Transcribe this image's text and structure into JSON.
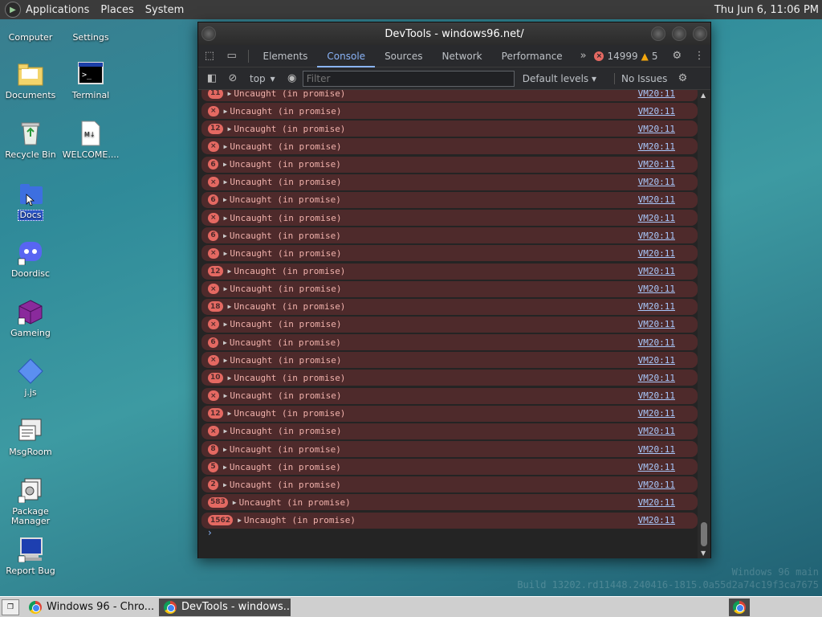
{
  "top_panel": {
    "menus": [
      "Applications",
      "Places",
      "System"
    ],
    "clock": "Thu Jun  6, 11:06 PM"
  },
  "desktop_icons": [
    {
      "label": "Computer"
    },
    {
      "label": "Settings"
    },
    {
      "label": "Documents"
    },
    {
      "label": "Terminal"
    },
    {
      "label": "Recycle Bin"
    },
    {
      "label": "WELCOME...."
    },
    {
      "label": "Docs"
    },
    {
      "label": "Doordisc"
    },
    {
      "label": "Gameing"
    },
    {
      "label": "j.js"
    },
    {
      "label": "MsgRoom"
    },
    {
      "label": "Package Manager"
    },
    {
      "label": "Report Bug"
    }
  ],
  "devtools": {
    "title": "DevTools - windows96.net/",
    "tabs": [
      "Elements",
      "Console",
      "Sources",
      "Network",
      "Performance"
    ],
    "active_tab": "Console",
    "more_tabs": "»",
    "error_count": "14999",
    "warning_count": "5",
    "toolbar": {
      "context": "top",
      "filter_placeholder": "Filter",
      "levels": "Default levels",
      "issues": "No Issues"
    },
    "messages": [
      {
        "badge": "11",
        "text": "Uncaught (in promise)",
        "source": "VM20:11"
      },
      {
        "badge": "×",
        "text": "Uncaught (in promise)",
        "source": "VM20:11"
      },
      {
        "badge": "12",
        "text": "Uncaught (in promise)",
        "source": "VM20:11"
      },
      {
        "badge": "×",
        "text": "Uncaught (in promise)",
        "source": "VM20:11"
      },
      {
        "badge": "6",
        "text": "Uncaught (in promise)",
        "source": "VM20:11"
      },
      {
        "badge": "×",
        "text": "Uncaught (in promise)",
        "source": "VM20:11"
      },
      {
        "badge": "6",
        "text": "Uncaught (in promise)",
        "source": "VM20:11"
      },
      {
        "badge": "×",
        "text": "Uncaught (in promise)",
        "source": "VM20:11"
      },
      {
        "badge": "6",
        "text": "Uncaught (in promise)",
        "source": "VM20:11"
      },
      {
        "badge": "×",
        "text": "Uncaught (in promise)",
        "source": "VM20:11"
      },
      {
        "badge": "12",
        "text": "Uncaught (in promise)",
        "source": "VM20:11"
      },
      {
        "badge": "×",
        "text": "Uncaught (in promise)",
        "source": "VM20:11"
      },
      {
        "badge": "18",
        "text": "Uncaught (in promise)",
        "source": "VM20:11"
      },
      {
        "badge": "×",
        "text": "Uncaught (in promise)",
        "source": "VM20:11"
      },
      {
        "badge": "6",
        "text": "Uncaught (in promise)",
        "source": "VM20:11"
      },
      {
        "badge": "×",
        "text": "Uncaught (in promise)",
        "source": "VM20:11"
      },
      {
        "badge": "10",
        "text": "Uncaught (in promise)",
        "source": "VM20:11"
      },
      {
        "badge": "×",
        "text": "Uncaught (in promise)",
        "source": "VM20:11"
      },
      {
        "badge": "12",
        "text": "Uncaught (in promise)",
        "source": "VM20:11"
      },
      {
        "badge": "×",
        "text": "Uncaught (in promise)",
        "source": "VM20:11"
      },
      {
        "badge": "8",
        "text": "Uncaught (in promise)",
        "source": "VM20:11"
      },
      {
        "badge": "5",
        "text": "Uncaught (in promise)",
        "source": "VM20:11"
      },
      {
        "badge": "2",
        "text": "Uncaught (in promise)",
        "source": "VM20:11"
      },
      {
        "badge": "583",
        "text": "Uncaught (in promise)",
        "source": "VM20:11"
      },
      {
        "badge": "1562",
        "text": "Uncaught (in promise)",
        "source": "VM20:11"
      }
    ],
    "prompt": "›"
  },
  "watermark": {
    "line1": "Windows 96 main",
    "line2": "Build 13202.rd11448.240416-1815.0a55d2a74c19f3ca7675"
  },
  "taskbar": {
    "show_desktop": "❐",
    "tasks": [
      {
        "label": "Windows 96 - Chro..."
      },
      {
        "label": "DevTools - windows..."
      }
    ]
  },
  "colors": {
    "error_badge": "#e46962",
    "error_row": "#4e2a2b",
    "active_tab": "#8ab4f8"
  }
}
